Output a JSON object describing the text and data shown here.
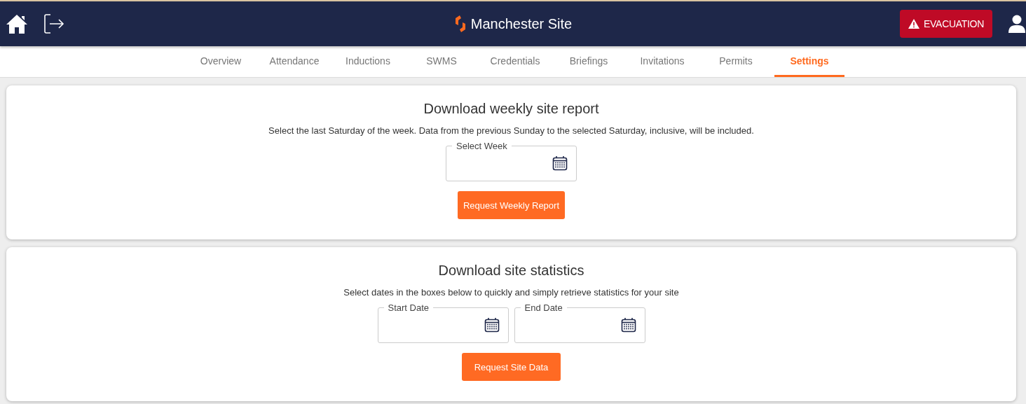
{
  "header": {
    "site_name": "Manchester Site",
    "evacuation_button": "EVACUATION"
  },
  "tabs": [
    {
      "label": "Overview",
      "selected": false
    },
    {
      "label": "Attendance",
      "selected": false
    },
    {
      "label": "Inductions",
      "selected": false
    },
    {
      "label": "SWMS",
      "selected": false
    },
    {
      "label": "Credentials",
      "selected": false
    },
    {
      "label": "Briefings",
      "selected": false
    },
    {
      "label": "Invitations",
      "selected": false
    },
    {
      "label": "Permits",
      "selected": false
    },
    {
      "label": "Settings",
      "selected": true
    }
  ],
  "cards": [
    {
      "title": "Download weekly site report",
      "description": "Select the last Saturday of the week. Data from the previous Sunday to the selected Saturday, inclusive, will be included.",
      "fields": [
        {
          "label": "Select Week"
        }
      ],
      "button": "Request Weekly Report"
    },
    {
      "title": "Download site statistics",
      "description": "Select dates in the boxes below to quickly and simply retrieve statistics for your site",
      "fields": [
        {
          "label": "Start Date"
        },
        {
          "label": "End Date"
        }
      ],
      "button": "Request Site Data"
    }
  ]
}
